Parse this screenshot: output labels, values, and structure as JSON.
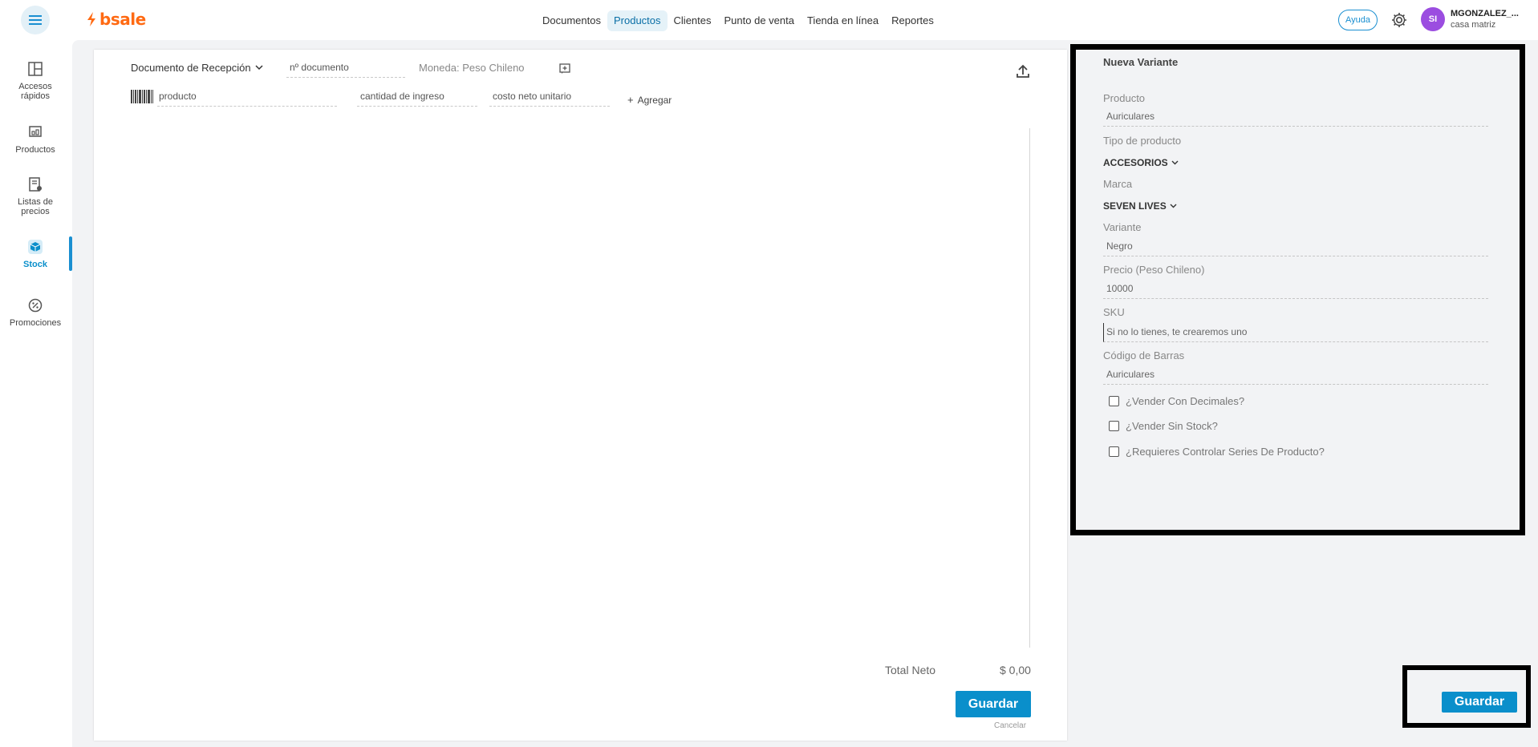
{
  "topbar": {
    "logo": "bsale",
    "nav": [
      "Documentos",
      "Productos",
      "Clientes",
      "Punto de venta",
      "Tienda en línea",
      "Reportes"
    ],
    "active_nav": "Productos",
    "help_label": "Ayuda",
    "avatar_initials": "SI",
    "user_name": "MGONZALEZ_...",
    "user_branch": "casa matriz"
  },
  "sidebar": {
    "items": [
      {
        "label": "Accesos rápidos",
        "icon": "dashboard-icon"
      },
      {
        "label": "Productos",
        "icon": "products-icon"
      },
      {
        "label": "Listas de precios",
        "icon": "price-list-icon"
      },
      {
        "label": "Stock",
        "icon": "box-icon"
      },
      {
        "label": "Promociones",
        "icon": "promotion-icon"
      }
    ],
    "active": "Stock"
  },
  "document": {
    "type_label": "Documento de Recepción",
    "doc_number_placeholder": "nº documento",
    "currency_label": "Moneda: Peso Chileno",
    "product_placeholder": "producto",
    "quantity_placeholder": "cantidad de ingreso",
    "cost_placeholder": "costo neto unitario",
    "add_label": "Agregar",
    "total_label": "Total Neto",
    "total_value": "$ 0,00",
    "save_label": "Guardar",
    "cancel_label": "Cancelar"
  },
  "variant_panel": {
    "title": "Nueva Variante",
    "product_label": "Producto",
    "product_value": "Auriculares",
    "type_label": "Tipo de producto",
    "type_value": "ACCESORIOS",
    "brand_label": "Marca",
    "brand_value": "SEVEN LIVES",
    "variant_label": "Variante",
    "variant_value": "Negro",
    "price_label": "Precio (Peso Chileno)",
    "price_value": "10000",
    "sku_label": "SKU",
    "sku_placeholder": "Si no lo tienes, te crearemos uno",
    "barcode_label": "Código de Barras",
    "barcode_value": "Auriculares",
    "checks": [
      "¿Vender Con Decimales?",
      "¿Vender Sin Stock?",
      "¿Requieres Controlar Series De Producto?"
    ],
    "save_label": "Guardar"
  },
  "colors": {
    "brand": "#ff6a13",
    "accent": "#0a8fcb",
    "avatar": "#9b4de0"
  }
}
